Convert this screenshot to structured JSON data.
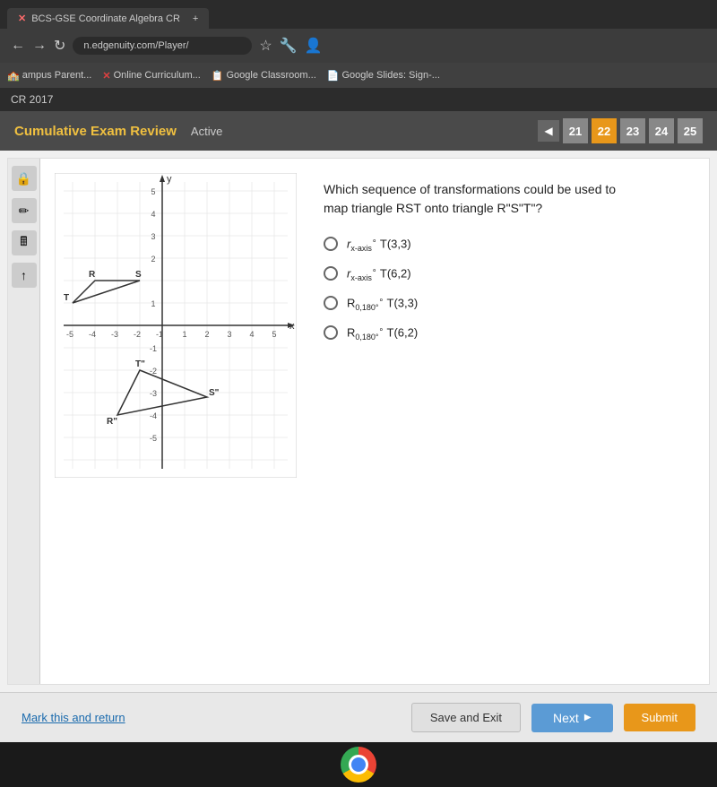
{
  "browser": {
    "tab_label": "BCS-GSE Coordinate Algebra CR",
    "address": "n.edgenuity.com/Player/",
    "bookmarks": [
      {
        "label": "ampus Parent..."
      },
      {
        "label": "Online Curriculum..."
      },
      {
        "label": "Google Classroom..."
      },
      {
        "label": "Google Slides: Sign-..."
      }
    ]
  },
  "app": {
    "header_label": "CR 2017",
    "exam_title": "Cumulative Exam Review",
    "exam_status": "Active",
    "question_numbers": [
      21,
      22,
      23,
      24,
      25
    ],
    "active_question": 22
  },
  "question": {
    "text_line1": "Which sequence of transformations could be used to",
    "text_line2": "map triangle RST onto triangle R\"S\"T\"?",
    "choices": [
      {
        "id": "a",
        "label": "r",
        "sub": "x-axis",
        "sup": "∘",
        "transform": "T(3,3)"
      },
      {
        "id": "b",
        "label": "r",
        "sub": "x-axis",
        "sup": "∘",
        "transform": "T(6,2)"
      },
      {
        "id": "c",
        "label": "R",
        "sub": "0,180°",
        "sup": "∘",
        "transform": "T(3,3)"
      },
      {
        "id": "d",
        "label": "R",
        "sub": "0,180°",
        "sup": "∘",
        "transform": "T(6,2)"
      }
    ]
  },
  "footer": {
    "mark_return_label": "Mark this and return",
    "save_exit_label": "Save and Exit",
    "next_label": "Next",
    "submit_label": "Submit"
  },
  "icons": {
    "lock": "🔒",
    "pencil": "✏",
    "calc": "🖩",
    "arrow_up": "↑"
  }
}
